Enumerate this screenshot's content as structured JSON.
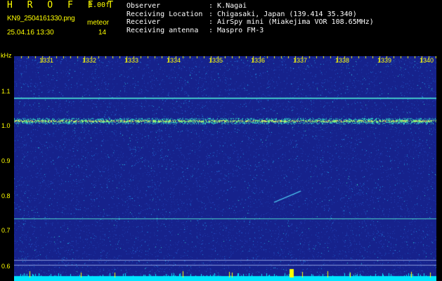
{
  "header": {
    "app_title": "H R O F F T",
    "version": "1.00f",
    "filename": "KN9_2504161330.png",
    "timestamp": "25.04.16 13:30",
    "meteor_label": "meteor",
    "meteor_count": "14"
  },
  "info": [
    {
      "key": "Observer",
      "value": ": K.Nagai"
    },
    {
      "key": "Receiving Location",
      "value": ": Chigasaki, Japan (139.414 35.340)"
    },
    {
      "key": "Receiver",
      "value": ": AirSpy mini (Miakejima VOR 108.65MHz)"
    },
    {
      "key": "Receiving antenna",
      "value": ": Maspro FM-3"
    }
  ],
  "axis": {
    "y_unit": "kHz",
    "y_ticks": [
      "1.1",
      "1.0",
      "0.9",
      "0.8",
      "0.7",
      "0.6"
    ],
    "x_ticks": [
      "1331",
      "1332",
      "1333",
      "1334",
      "1335",
      "1336",
      "1337",
      "1338",
      "1339",
      "1340"
    ]
  },
  "colors": {
    "label": "#ffff00",
    "background": "#1a2a9a",
    "carrier": "#55ffcc",
    "noise_bar": "#00e5ff"
  }
}
